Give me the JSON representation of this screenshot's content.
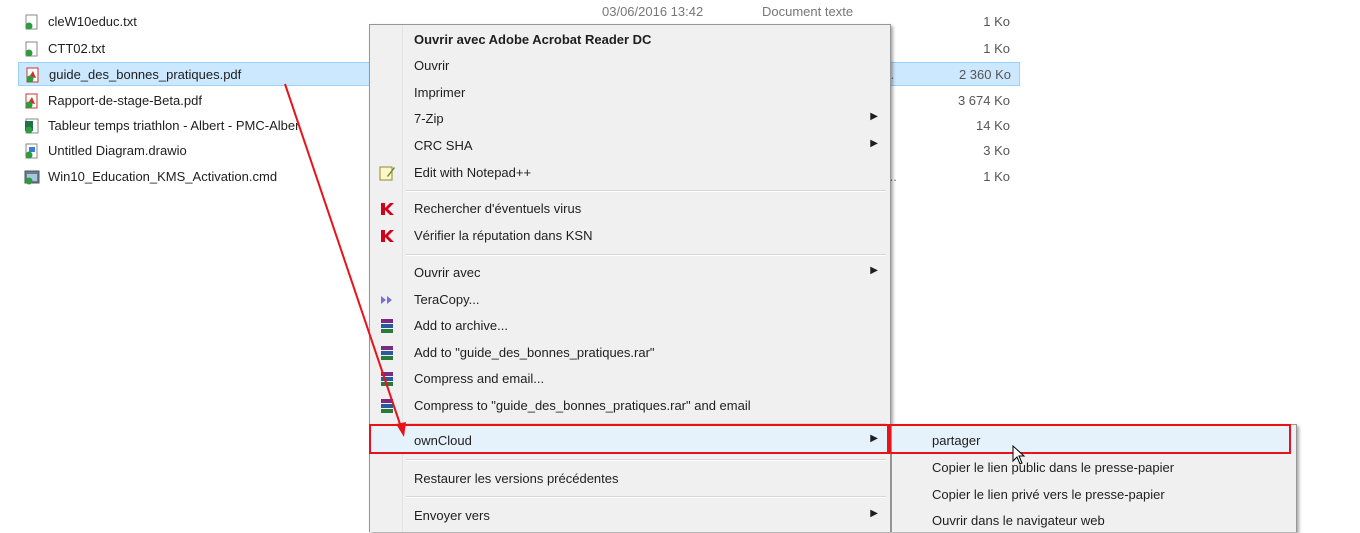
{
  "files": [
    {
      "name": "cleW10educ.txt",
      "date": "03/06/2016 13:42",
      "type": "Document texte",
      "size": "1 Ko",
      "icon": "text-file-icon"
    },
    {
      "name": "CTT02.txt",
      "size": "1 Ko",
      "icon": "text-file-icon"
    },
    {
      "name": "guide_des_bonnes_pratiques.pdf",
      "size": "2 360 Ko",
      "ellipsis": "..",
      "icon": "pdf-file-icon",
      "selected": true
    },
    {
      "name": "Rapport-de-stage-Beta.pdf",
      "size": "3 674 Ko",
      "ellipsis": ".",
      "icon": "pdf-file-icon"
    },
    {
      "name": "Tableur temps triathlon - Albert - PMC-Alber",
      "size": "14 Ko",
      "icon": "spreadsheet-file-icon"
    },
    {
      "name": "Untitled Diagram.drawio",
      "size": "3 Ko",
      "icon": "drawio-file-icon"
    },
    {
      "name": "Win10_Education_KMS_Activation.cmd",
      "size": "1 Ko",
      "ellipsis": "...",
      "icon": "cmd-file-icon"
    }
  ],
  "context_menu": {
    "open_acrobat": "Ouvrir avec Adobe Acrobat Reader DC",
    "open": "Ouvrir",
    "print": "Imprimer",
    "zip": "7-Zip",
    "crc": "CRC SHA",
    "notepad": "Edit with Notepad++",
    "scan_virus": "Rechercher d'éventuels virus",
    "ksn": "Vérifier la réputation dans KSN",
    "open_with": "Ouvrir avec",
    "teracopy": "TeraCopy...",
    "add_archive": "Add to archive...",
    "add_rar": "Add to \"guide_des_bonnes_pratiques.rar\"",
    "compress_email": "Compress and email...",
    "compress_rar_email": "Compress to \"guide_des_bonnes_pratiques.rar\" and email",
    "owncloud": "ownCloud",
    "restore": "Restaurer les versions précédentes",
    "send_to": "Envoyer vers"
  },
  "owncloud_submenu": {
    "share": "partager",
    "copy_public": "Copier le lien public dans le presse-papier",
    "copy_private": "Copier le lien privé vers le presse-papier",
    "open_browser": "Ouvrir dans le navigateur web"
  },
  "colors": {
    "annotation": "#e8121b",
    "selection": "#cce8ff",
    "menu_bg": "#f0f0f0"
  }
}
